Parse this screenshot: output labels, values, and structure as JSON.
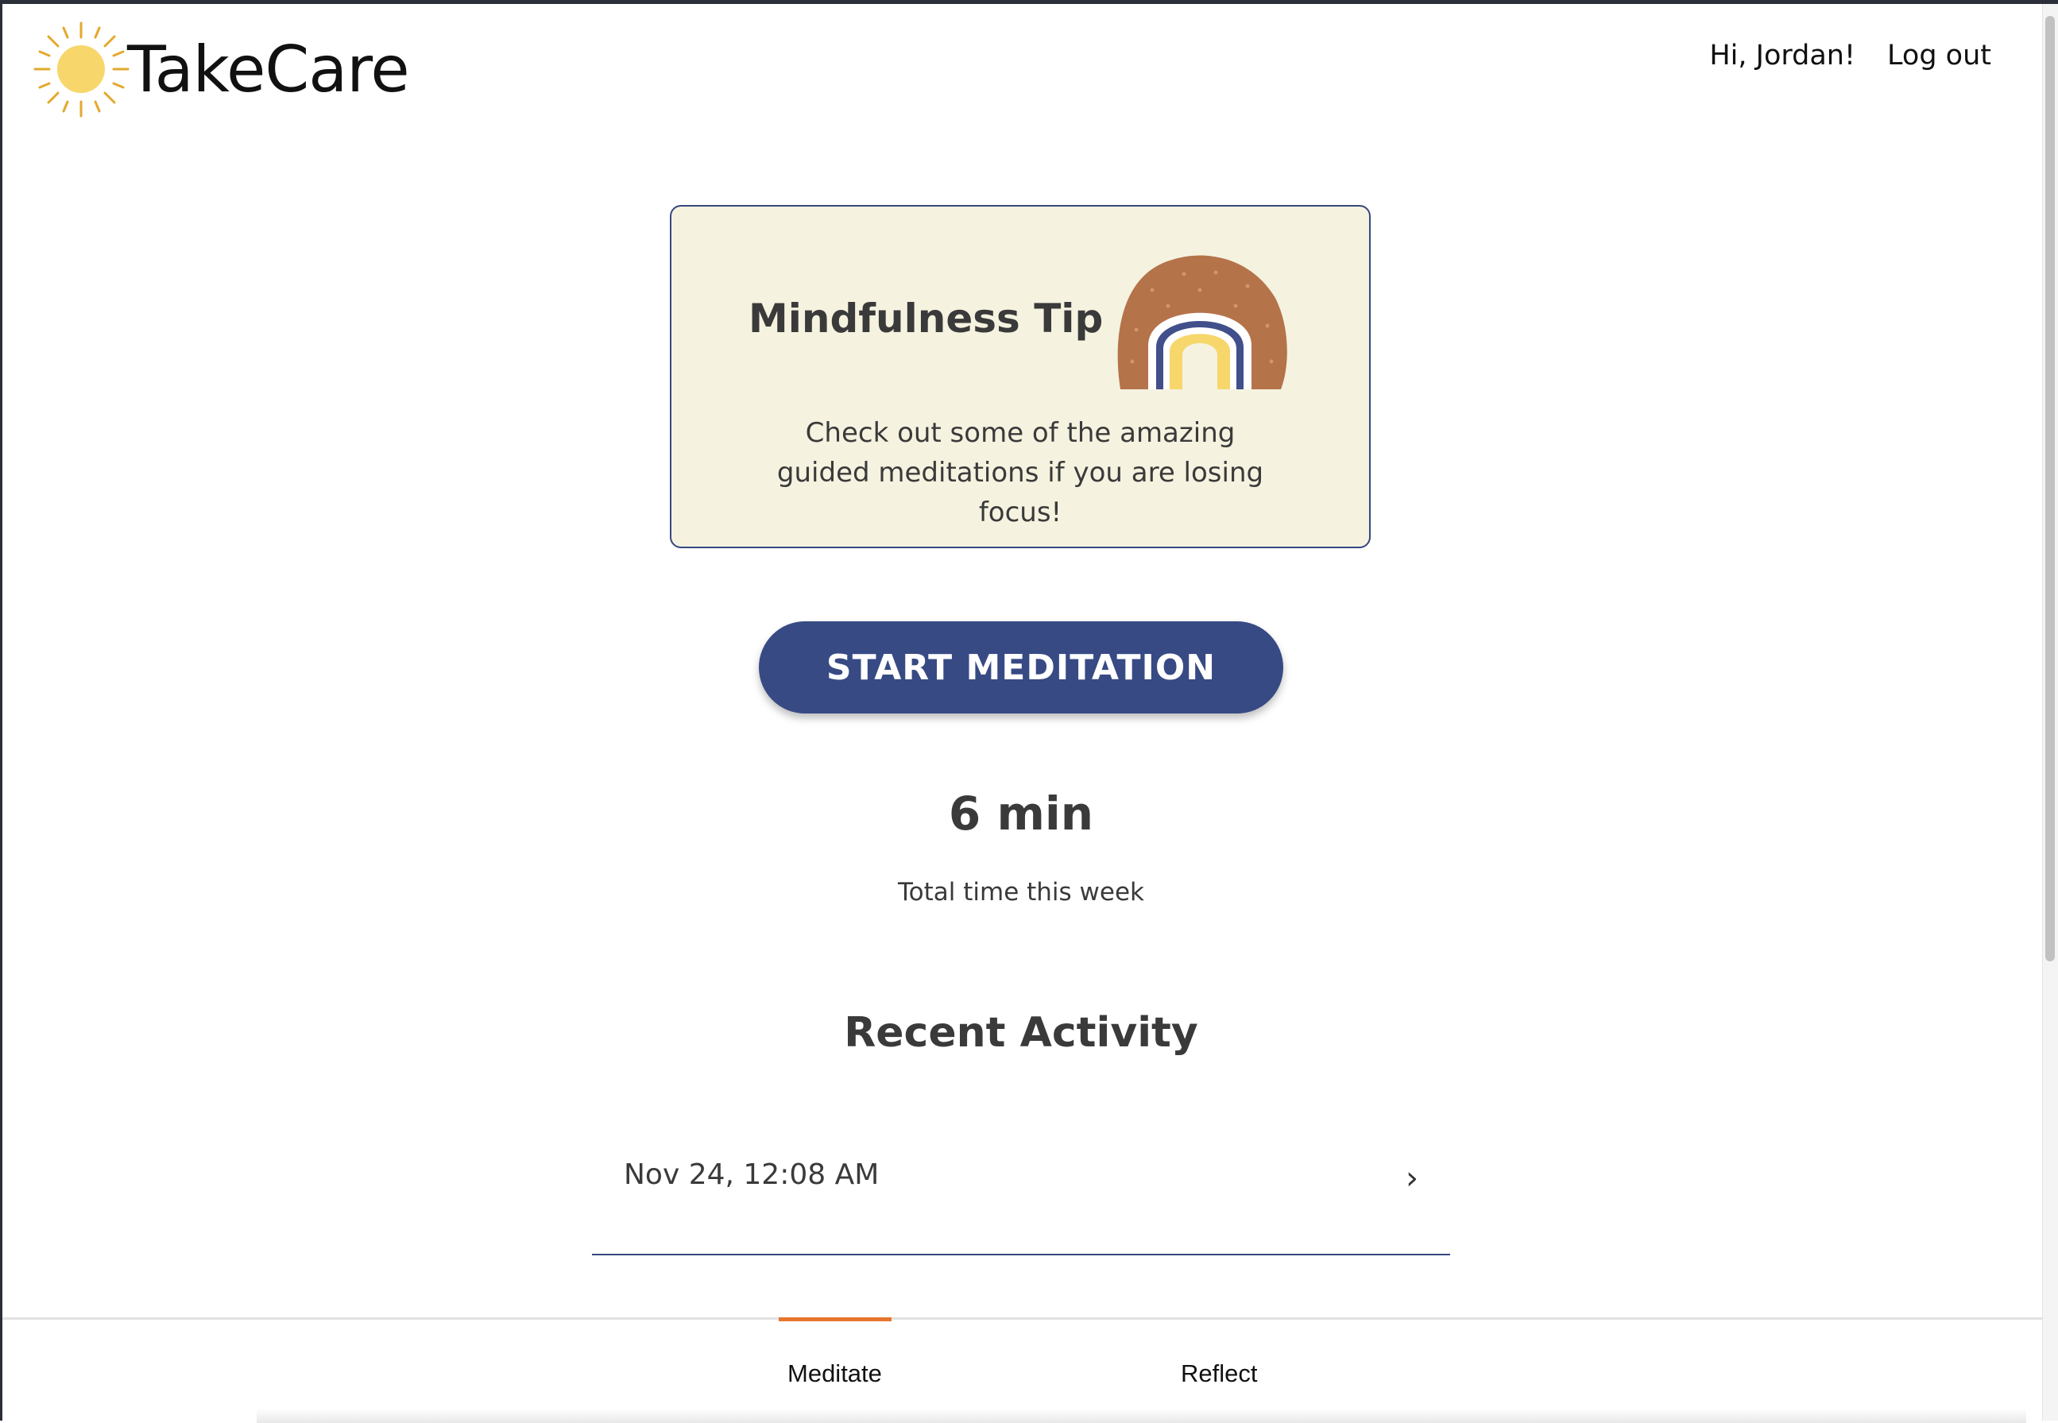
{
  "header": {
    "app_name": "TakeCare",
    "greeting": "Hi, Jordan!",
    "logout_label": "Log out"
  },
  "tip": {
    "title": "Mindfulness Tip",
    "text": "Check out some of the amazing guided meditations if you are losing focus!"
  },
  "start_button": {
    "label": "START MEDITATION"
  },
  "stats": {
    "total_value": "6 min",
    "total_label": "Total time this week"
  },
  "recent": {
    "title": "Recent Activity",
    "items": [
      {
        "date": "Nov 24, 12:08 AM",
        "chevron": "›"
      }
    ]
  },
  "bottom_nav": {
    "tabs": [
      {
        "label": "Meditate",
        "active": true
      },
      {
        "label": "Reflect",
        "active": false
      }
    ]
  },
  "colors": {
    "primary": "#374a84",
    "accent": "#e6762e",
    "card_bg": "#f5f2e0",
    "sun": "#f7d66b",
    "arch_brown": "#b5734a"
  }
}
